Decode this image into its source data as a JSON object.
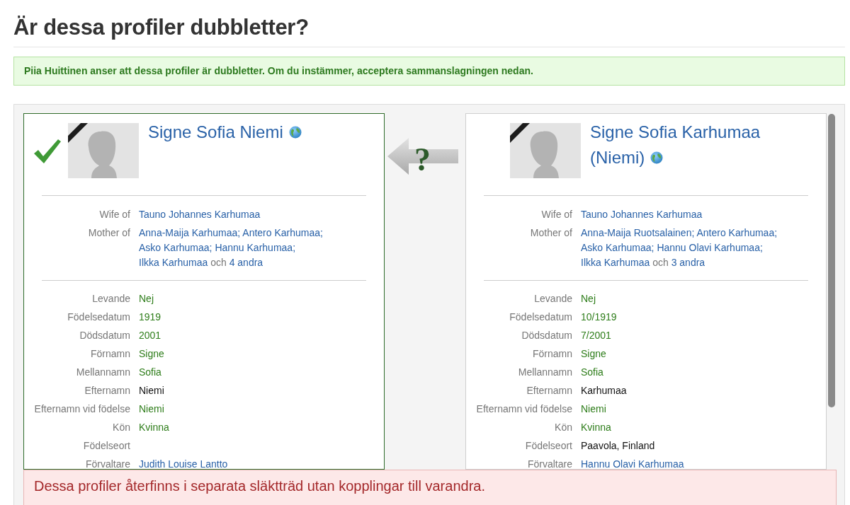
{
  "title": "Är dessa profiler dubbletter?",
  "notice": "Piia Huittinen anser att dessa profiler är dubbletter. Om du instämmer, acceptera sammanslagningen nedan.",
  "profiles": [
    {
      "name": "Signe Sofia Niemi",
      "selected": true,
      "deceased": true,
      "relations": [
        {
          "label": "Wife of",
          "names": [
            "Tauno Johannes Karhumaa"
          ]
        },
        {
          "label": "Mother of",
          "names": [
            "Anna-Maija Karhumaa",
            "Antero Karhumaa",
            "Asko Karhumaa",
            "Hannu Karhumaa",
            "Ilkka Karhumaa"
          ],
          "separator": ";",
          "conjunction": "och",
          "more": "4 andra"
        }
      ],
      "fields": [
        {
          "label": "Levande",
          "value": "Nej",
          "kind": "match"
        },
        {
          "label": "Födelsedatum",
          "value": "1919",
          "kind": "match"
        },
        {
          "label": "Dödsdatum",
          "value": "2001",
          "kind": "match"
        },
        {
          "label": "Förnamn",
          "value": "Signe",
          "kind": "match"
        },
        {
          "label": "Mellannamn",
          "value": "Sofia",
          "kind": "match"
        },
        {
          "label": "Efternamn",
          "value": "Niemi",
          "kind": "differs"
        },
        {
          "label": "Efternamn vid födelse",
          "value": "Niemi",
          "kind": "match"
        },
        {
          "label": "Kön",
          "value": "Kvinna",
          "kind": "match"
        },
        {
          "label": "Födelseort"
        },
        {
          "label": "Förvaltare",
          "value": "Judith Louise Lantto",
          "kind": "link"
        }
      ]
    },
    {
      "name": "Signe Sofia Karhumaa (Niemi)",
      "selected": false,
      "deceased": true,
      "relations": [
        {
          "label": "Wife of",
          "names": [
            "Tauno Johannes Karhumaa"
          ]
        },
        {
          "label": "Mother of",
          "names": [
            "Anna-Maija Ruotsalainen",
            "Antero Karhumaa",
            "Asko Karhumaa",
            "Hannu Olavi Karhumaa",
            "Ilkka Karhumaa"
          ],
          "separator": ";",
          "conjunction": "och",
          "more": "3 andra"
        }
      ],
      "fields": [
        {
          "label": "Levande",
          "value": "Nej",
          "kind": "match"
        },
        {
          "label": "Födelsedatum",
          "value": "10/1919",
          "kind": "match"
        },
        {
          "label": "Dödsdatum",
          "value": "7/2001",
          "kind": "match"
        },
        {
          "label": "Förnamn",
          "value": "Signe",
          "kind": "match"
        },
        {
          "label": "Mellannamn",
          "value": "Sofia",
          "kind": "match"
        },
        {
          "label": "Efternamn",
          "value": "Karhumaa",
          "kind": "differs"
        },
        {
          "label": "Efternamn vid födelse",
          "value": "Niemi",
          "kind": "match"
        },
        {
          "label": "Kön",
          "value": "Kvinna",
          "kind": "match"
        },
        {
          "label": "Födelseort",
          "value": "Paavola, Finland",
          "kind": "differs"
        },
        {
          "label": "Förvaltare",
          "value": "Hannu Olavi Karhumaa",
          "kind": "link"
        }
      ]
    }
  ],
  "merge_arrow": {
    "symbol": "?"
  },
  "warning": {
    "heading": "Dessa profiler återfinns i separata släktträd utan kopplingar till varandra."
  }
}
